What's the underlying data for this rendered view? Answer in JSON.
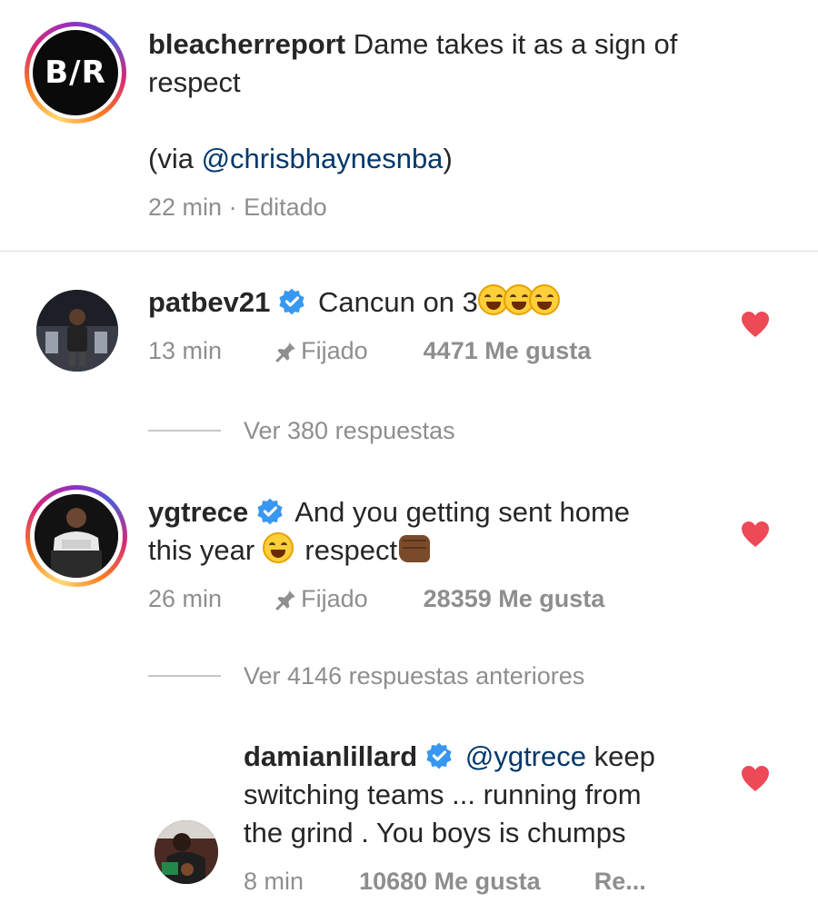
{
  "post": {
    "username": "bleacherreport",
    "caption_line1": "Dame takes it as a sign of",
    "caption_line2": "respect",
    "via_prefix": "(via ",
    "via_mention": "@chrisbhaynesnba",
    "via_suffix": ")",
    "avatar_text": "B/R",
    "time": "22 min",
    "separator": "·",
    "edited": "Editado"
  },
  "comments": [
    {
      "username": "patbev21",
      "text_line1": "Cancun on 3",
      "emoji": "😂😂😂",
      "time": "13 min",
      "pinned": "Fijado",
      "likes": "4471 Me gusta",
      "view_replies": "Ver 380 respuestas"
    },
    {
      "username": "ygtrece",
      "text_line1": "And you getting sent home",
      "text_line2a": "this year",
      "emoji_mid": "🤣",
      "text_line2b": "respect",
      "emoji_end": "✊🏿",
      "time": "26 min",
      "pinned": "Fijado",
      "likes": "28359 Me gusta",
      "view_replies": "Ver 4146 respuestas anteriores"
    }
  ],
  "reply": {
    "username": "damianlillard",
    "mention": "@ygtrece",
    "text_line1": "keep",
    "text_line2": "switching teams ... running from",
    "text_line3": "the grind . You boys is chumps",
    "time": "8 min",
    "likes": "10680 Me gusta",
    "reply_label": "Re..."
  },
  "colors": {
    "heart": "#ed4956",
    "verified": "#3897f0",
    "mention": "#00376b",
    "meta": "#8e8e8e"
  }
}
